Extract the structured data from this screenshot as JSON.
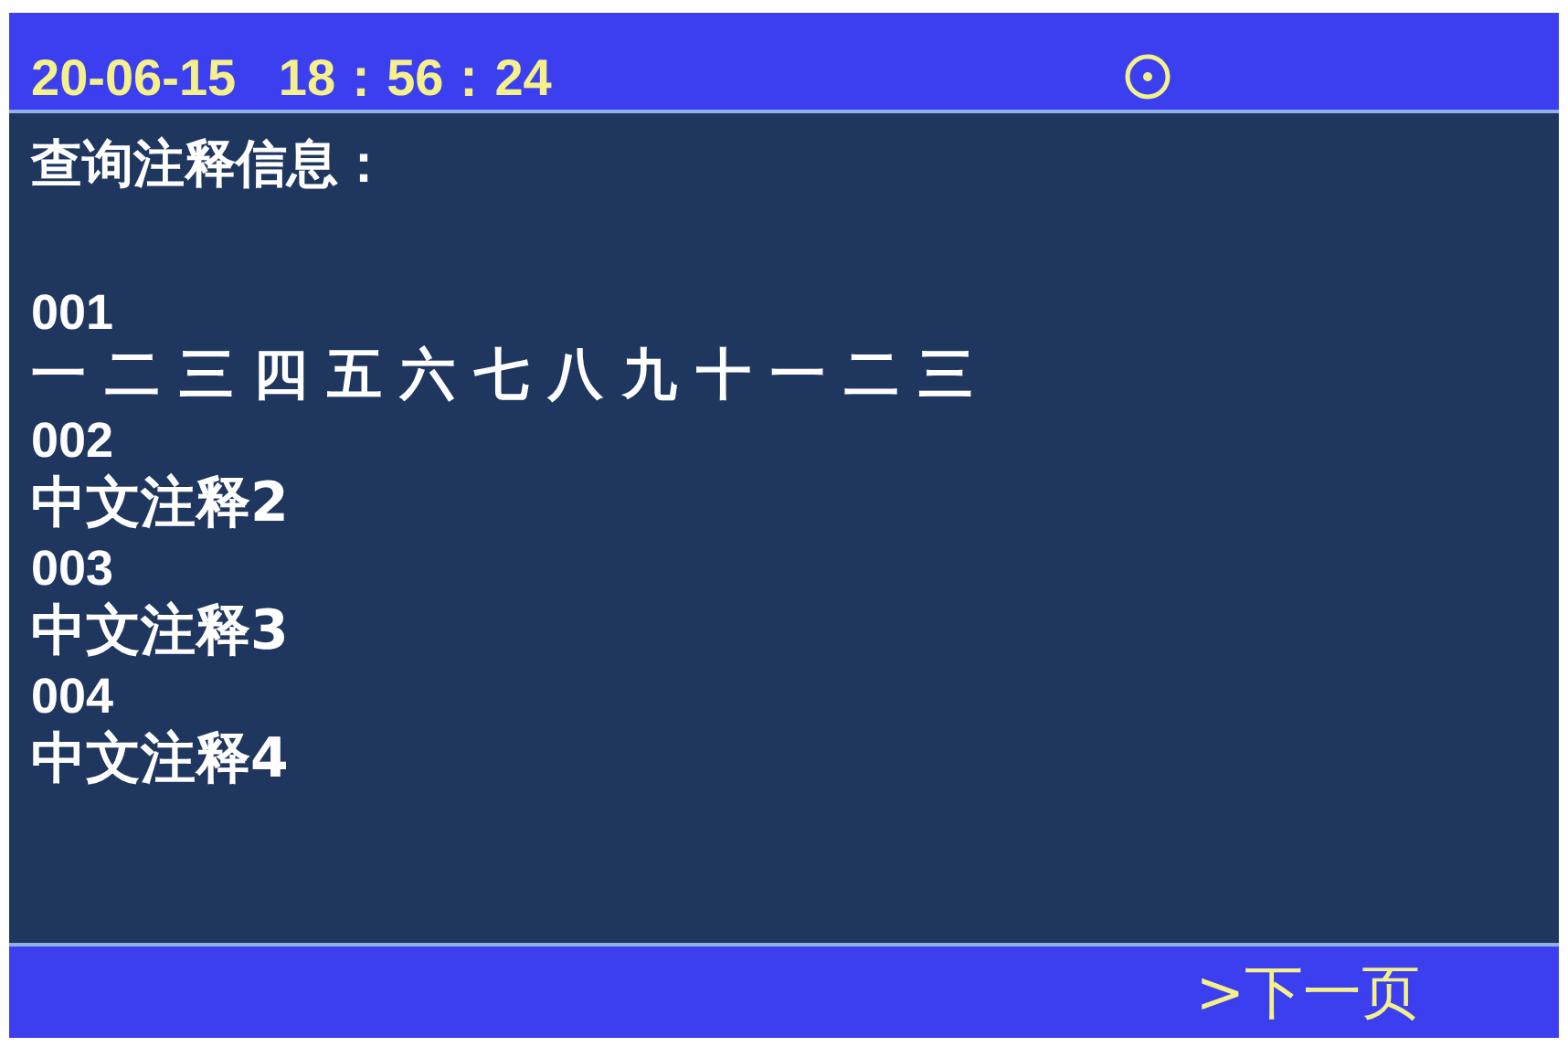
{
  "status_bar": {
    "datetime": "20-06-15   18：56：24"
  },
  "heading": "查询注释信息：",
  "entries": [
    {
      "number": "001",
      "text": "一 二 三 四 五 六 七 八 九 十 一 二 三"
    },
    {
      "number": "002",
      "text": "中文注释2"
    },
    {
      "number": "003",
      "text": "中文注释3"
    },
    {
      "number": "004",
      "text": "中文注释4"
    }
  ],
  "footer": {
    "next_page": ">下一页"
  }
}
